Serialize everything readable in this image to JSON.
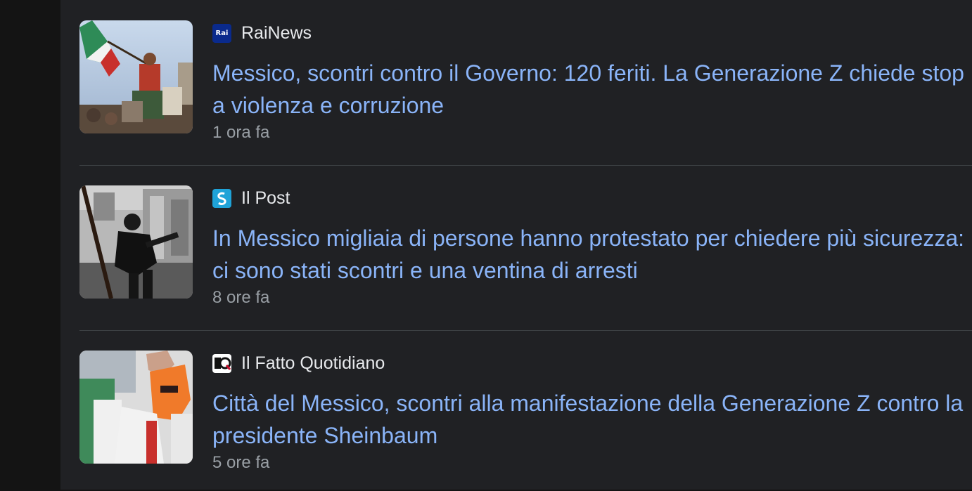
{
  "articles": [
    {
      "source": "RaiNews",
      "source_icon": "rai-logo-icon",
      "icon_text": "Rai",
      "headline": "Messico, scontri contro il Governo: 120 feriti. La Generazione Z chiede stop a violenza e corruzione",
      "time": "1 ora fa",
      "thumbnail": "protester-with-flag-image"
    },
    {
      "source": "Il Post",
      "source_icon": "ilpost-logo-icon",
      "headline": "In Messico migliaia di persone hanno protestato per chiedere più sicurezza: ci sono stati scontri e una ventina di arresti",
      "time": "8 ore fa",
      "thumbnail": "riot-police-image"
    },
    {
      "source": "Il Fatto Quotidiano",
      "source_icon": "ilfatto-logo-icon",
      "headline": "Città del Messico, scontri alla manifestazione della Generazione Z contro la presidente Sheinbaum",
      "time": "5 ore fa",
      "thumbnail": "masked-protester-image"
    }
  ],
  "colors": {
    "background": "#202124",
    "headline": "#8ab4f8",
    "source_text": "#e8eaed",
    "time_text": "#9aa0a6",
    "divider": "#3c4043"
  }
}
